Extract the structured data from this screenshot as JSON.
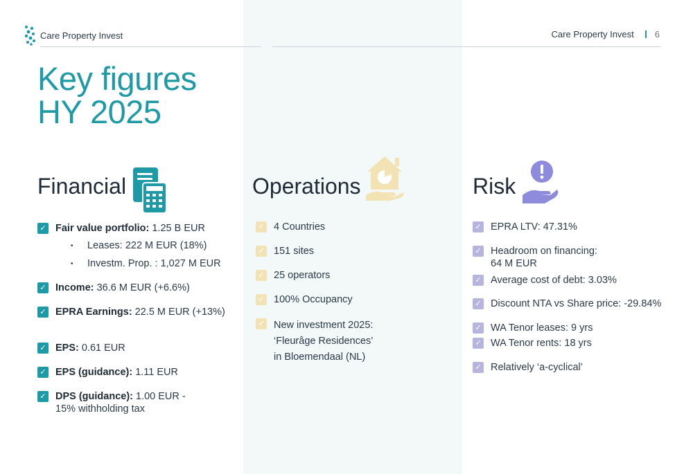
{
  "header": {
    "brand": "Care Property Invest",
    "right_brand": "Care Property Invest",
    "page_number": "6"
  },
  "title": {
    "line1": "Key figures",
    "line2": "HY 2025"
  },
  "financial": {
    "heading": "Financial",
    "icon": "calculator-document-icon",
    "items": [
      {
        "label": "Fair value portfolio:",
        "value": " 1.25 B EUR"
      },
      {
        "label": "Income:",
        "value": " 36.6 M EUR (+6.6%)"
      },
      {
        "label": "EPRA Earnings:",
        "value": " 22.5 M EUR  (+13%)"
      },
      {
        "label": "EPS:",
        "value": " 0.61 EUR"
      },
      {
        "label": "EPS (guidance):",
        "value": " 1.11 EUR"
      },
      {
        "label": "DPS (guidance):",
        "value": " 1.00 EUR -",
        "value_line2": "15% withholding tax"
      }
    ],
    "sub_items": [
      "Leases: 222 M EUR (18%)",
      "Investm. Prop. : 1,027 M EUR"
    ]
  },
  "operations": {
    "heading": "Operations",
    "icon": "house-chart-hand-icon",
    "items": [
      {
        "text": "4 Countries"
      },
      {
        "text": "151 sites"
      },
      {
        "text": "25 operators"
      },
      {
        "text": "100% Occupancy"
      },
      {
        "text": "New investment 2025:",
        "line2": "‘Fleurâge Residences’",
        "line3": "in Bloemendaal (NL)"
      }
    ]
  },
  "risk": {
    "heading": "Risk",
    "icon": "alert-hand-icon",
    "items": [
      {
        "text": "EPRA LTV: 47.31%"
      },
      {
        "text": "Headroom on financing:",
        "line2": "64 M EUR"
      },
      {
        "text": "Average cost of debt: 3.03%"
      },
      {
        "text": "Discount NTA vs Share price: -29.84%"
      },
      {
        "text": "WA Tenor leases: 9 yrs"
      },
      {
        "text": "WA Tenor rents: 18 yrs"
      },
      {
        "text": "Relatively ‘a-cyclical’"
      }
    ]
  },
  "colors": {
    "teal": "#1e9aa6",
    "sand": "#f2e2b4",
    "lavender": "#b7b4de",
    "band": "#f3f8f8"
  }
}
